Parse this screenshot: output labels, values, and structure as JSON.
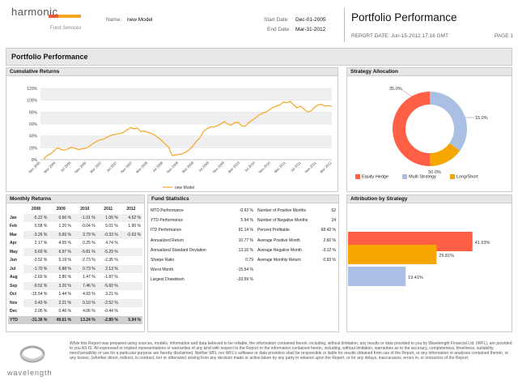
{
  "header": {
    "logo_text": "harmonic",
    "logo_sub": "Fund Services",
    "name_label": "Name:",
    "name_value": "new Model",
    "start_label": "Start Date:",
    "start_value": "Dec-01-2005",
    "end_label": "End Date:",
    "end_value": "Mar-31-2012",
    "title": "Portfolio Performance",
    "report_date": "REPORT DATE:  Jun-15-2012 17:16 GMT",
    "page": "PAGE 1"
  },
  "section_title": "Portfolio Performance",
  "cumulative": {
    "title": "Cumulative Returns",
    "legend": "new Model",
    "line_color": "#f5a623"
  },
  "strategy": {
    "title": "Strategy Allocation",
    "labels": [
      "35.0%",
      "15.0%",
      "50.0%"
    ],
    "legend": [
      "Equity Hedge",
      "Multi Strategy",
      "Long/Short"
    ],
    "colors": [
      "#ff5f45",
      "#a9bfe3",
      "#f5a700"
    ]
  },
  "monthly": {
    "title": "Monthly Returns",
    "years": [
      "2008",
      "2009",
      "2010",
      "2011",
      "2012"
    ],
    "rows": [
      [
        "Jan",
        "-5.22 %",
        "0.66 %",
        "-1.01 %",
        "1.06 %",
        "4.62 %"
      ],
      [
        "Feb",
        "0.58 %",
        "1.20 %",
        "-0.04 %",
        "5.01 %",
        "1.90 %"
      ],
      [
        "Mar",
        "-3.26 %",
        "5.65 %",
        "3.79 %",
        "-0.33 %",
        "-0.63 %"
      ],
      [
        "Apr",
        "2.17 %",
        "4.55 %",
        "0.25 %",
        "4.74 %",
        ""
      ],
      [
        "May",
        "0.69 %",
        "6.97 %",
        "-5.81 %",
        "-5.29 %",
        ""
      ],
      [
        "Jun",
        "-3.52 %",
        "5.19 %",
        "-2.73 %",
        "-2.35 %",
        ""
      ],
      [
        "Jul",
        "-1.70 %",
        "6.88 %",
        "0.73 %",
        "2.13 %",
        ""
      ],
      [
        "Aug",
        "-2.60 %",
        "2.85 %",
        "1.47 %",
        "-1.87 %",
        ""
      ],
      [
        "Sep",
        "-9.52 %",
        "3.20 %",
        "7.46 %",
        "-5.60 %",
        ""
      ],
      [
        "Oct",
        "-15.54 %",
        "1.44 %",
        "4.93 %",
        "3.21 %",
        ""
      ],
      [
        "Nov",
        "0.43 %",
        "2.21 %",
        "0.10 %",
        "-2.52 %",
        ""
      ],
      [
        "Dec",
        "2.05 %",
        "0.46 %",
        "4.06 %",
        "-0.44 %",
        ""
      ]
    ],
    "ytd": [
      "YTD",
      "-31.36 %",
      "49.61 %",
      "13.24 %",
      "-2.89 %",
      "5.94 %"
    ]
  },
  "fund_stats": {
    "title": "Fund Statistics",
    "left": [
      [
        "MTD Performance",
        "-0.63 %"
      ],
      [
        "YTD Performance",
        "5.94 %"
      ],
      [
        "ITD Performance",
        "91.14 %"
      ],
      [
        "Annualized Return",
        "10.77 %"
      ],
      [
        "Annualized Standard Deviation",
        "13.16 %"
      ],
      [
        "Sharpe Ratio",
        "0.79"
      ],
      [
        "Worst Month",
        "-15.54 %"
      ],
      [
        "Largest Drawdown",
        "-33.59 %"
      ]
    ],
    "right": [
      [
        "Number of Positive Months",
        "52"
      ],
      [
        "Number of Negative Months",
        "24"
      ],
      [
        "Percent Profitable",
        "68.42 %"
      ],
      [
        "Average Positive Month",
        "2.60 %"
      ],
      [
        "Average Negative Month",
        "-3.12 %"
      ],
      [
        "Average Monthly Return",
        "0.93 %"
      ]
    ]
  },
  "attribution": {
    "title": "Attribution by Strategy",
    "labels": [
      "41.93%",
      "29.81%",
      "19.41%"
    ],
    "colors": [
      "#ff5f45",
      "#f5a700",
      "#a9bfe3"
    ]
  },
  "chart_data": [
    {
      "type": "line",
      "title": "Cumulative Returns",
      "yticks": [
        "0%",
        "20%",
        "40%",
        "60%",
        "80%",
        "100%",
        "120%"
      ],
      "ylim": [
        0,
        120
      ],
      "xticks": [
        "Nov 2005",
        "Mar 2006",
        "Jul 2006",
        "Nov 2006",
        "Mar 2007",
        "Jul 2007",
        "Nov 2007",
        "Mar 2008",
        "Jul 2008",
        "Nov 2008",
        "Mar 2009",
        "Jul 2009",
        "Nov 2009",
        "Mar 2010",
        "Jul 2010",
        "Nov 2010",
        "Mar 2011",
        "Jul 2011",
        "Nov 2011",
        "Mar 2012"
      ],
      "series": [
        {
          "name": "new Model",
          "values": [
            1,
            7,
            10,
            15,
            20,
            17,
            16,
            18,
            21,
            19,
            17,
            18,
            19,
            22,
            26,
            30,
            33,
            34,
            37,
            40,
            42,
            43,
            44,
            46,
            50,
            54,
            52,
            53,
            47,
            48,
            46,
            44,
            41,
            37,
            32,
            26,
            21,
            7,
            8,
            9,
            10,
            13,
            17,
            23,
            31,
            37,
            47,
            52,
            55,
            55,
            57,
            60,
            64,
            60,
            58,
            62,
            63,
            57,
            56,
            62,
            66,
            70,
            75,
            78,
            80,
            84,
            88,
            90,
            92,
            97,
            96,
            98,
            92,
            87,
            90,
            85,
            80,
            82,
            88,
            92,
            93,
            90,
            91,
            90
          ]
        }
      ]
    },
    {
      "type": "pie",
      "title": "Strategy Allocation",
      "categories": [
        "Equity Hedge",
        "Multi Strategy",
        "Long/Short"
      ],
      "values": [
        50,
        35,
        15
      ]
    },
    {
      "type": "bar",
      "title": "Attribution by Strategy",
      "categories": [
        "Equity Hedge",
        "Long/Short",
        "Multi Strategy"
      ],
      "values": [
        41.93,
        29.81,
        19.41
      ]
    }
  ],
  "footer": {
    "logo": "wavelength",
    "disclaimer": "While this Report was prepared using sources, models, information and data believed to be reliable, the information contained herein, including, without limitation, any results or data provided to you by Wavelength Financial Ltd. (WFL), are provided to you AS IS. All expressed or implied representations or warranties of any kind with respect to the Report or the information contained herein, including, without limitation, warranties as to the accuracy, completeness, timeliness, suitability, merchantability or use for a particular purpose are hereby disclaimed. Neither WFL nor WFL's software or data providers shall be responsible or liable for results obtained from use of the Report, or any information or analyses contained therein, or any losses, (whether direct, indirect, in contract, tort or otherwise) arising from any decision made or action taken by any party in reliance upon the Report, or for any delays, inaccuracies, errors in, or omissions of the Report."
  }
}
